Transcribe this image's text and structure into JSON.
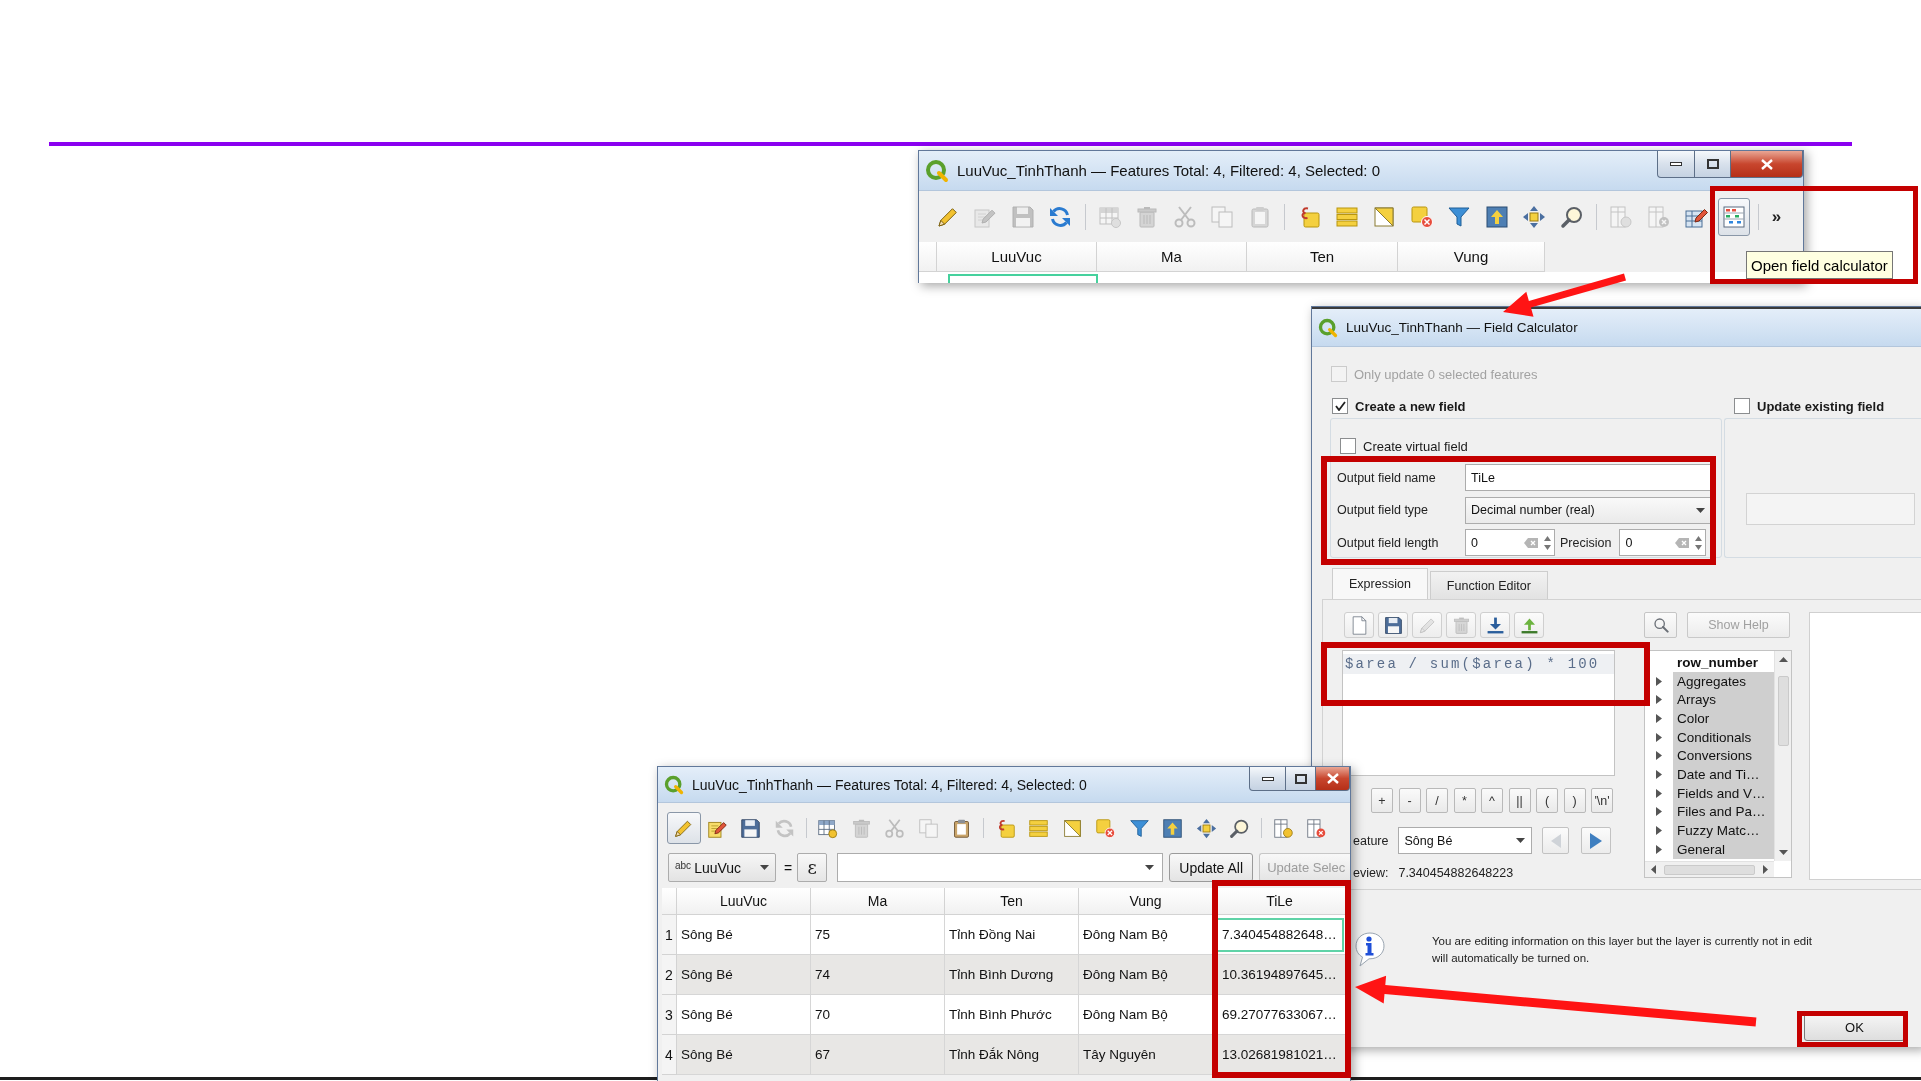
{
  "top_window": {
    "title": "LuuVuc_TinhThanh — Features Total: 4, Filtered: 4, Selected: 0",
    "toolbar": [
      [
        {
          "disabled": false,
          "active": false
        },
        {
          "disabled": true,
          "active": false
        },
        {
          "disabled": true,
          "active": false
        },
        {
          "disabled": false,
          "active": false
        }
      ],
      [
        {
          "disabled": true,
          "active": false
        },
        {
          "disabled": true,
          "active": false
        },
        {
          "disabled": true,
          "active": false
        },
        {
          "disabled": true,
          "active": false
        },
        {
          "disabled": true,
          "active": false
        }
      ],
      [
        {
          "disabled": false,
          "active": false
        },
        {
          "disabled": false,
          "active": false
        },
        {
          "disabled": false,
          "active": false
        },
        {
          "disabled": false,
          "active": false
        },
        {
          "disabled": false,
          "active": false
        },
        {
          "disabled": false,
          "active": false
        },
        {
          "disabled": false,
          "active": false
        },
        {
          "disabled": false,
          "active": false
        }
      ],
      [
        {
          "disabled": true,
          "active": false
        },
        {
          "disabled": true,
          "active": false
        },
        {
          "disabled": false,
          "active": false
        },
        {
          "disabled": false,
          "active": true
        }
      ]
    ],
    "overflow_button": "»",
    "columns": [
      "LuuVuc",
      "Ma",
      "Ten",
      "Vung"
    ],
    "partial_row": {
      "focused": true
    },
    "tooltip": "Open field calculator"
  },
  "field_calculator": {
    "title": "LuuVuc_TinhThanh — Field Calculator",
    "only_selected": {
      "label": "Only update 0 selected features",
      "checked": false,
      "disabled": true
    },
    "create_new_field": {
      "label": "Create a new field",
      "checked": true
    },
    "update_existing": {
      "label": "Update existing field",
      "checked": false
    },
    "virtual_field": {
      "label": "Create virtual field",
      "checked": false
    },
    "form": {
      "name_label": "Output field name",
      "name_value": "TiLe",
      "type_label": "Output field type",
      "type_value": "Decimal number (real)",
      "length_label": "Output field length",
      "length_value": "0",
      "precision_label": "Precision",
      "precision_value": "0"
    },
    "tabs": [
      {
        "label": "Expression",
        "selected": true
      },
      {
        "label": "Function Editor",
        "selected": false
      }
    ],
    "expression_toolbar": [
      {
        "disabled": false
      },
      {
        "disabled": false
      },
      {
        "disabled": true
      },
      {
        "disabled": true
      },
      {
        "disabled": false
      },
      {
        "disabled": false
      }
    ],
    "expression": "$area / sum($area) * 100",
    "operators": [
      "+",
      "-",
      "/",
      "*",
      "^",
      "||",
      "(",
      ")",
      "'\\n'"
    ],
    "feature": {
      "label": "eature",
      "value": "Sông Bé"
    },
    "feature_nav": [
      {
        "disabled": true
      },
      {
        "disabled": false
      }
    ],
    "preview": {
      "label": "eview:",
      "value": "7.340454882648223"
    },
    "show_help": {
      "label": "Show Help",
      "disabled": true
    },
    "functions": [
      {
        "label": "row_number",
        "kind": "function",
        "selected": false
      },
      {
        "label": "Aggregates",
        "kind": "group",
        "selected": true
      },
      {
        "label": "Arrays",
        "kind": "group",
        "selected": true
      },
      {
        "label": "Color",
        "kind": "group",
        "selected": true
      },
      {
        "label": "Conditionals",
        "kind": "group",
        "selected": true
      },
      {
        "label": "Conversions",
        "kind": "group",
        "selected": true
      },
      {
        "label": "Date and Ti…",
        "kind": "group",
        "selected": true
      },
      {
        "label": "Fields and V…",
        "kind": "group",
        "selected": true
      },
      {
        "label": "Files and Pa…",
        "kind": "group",
        "selected": true
      },
      {
        "label": "Fuzzy Matc…",
        "kind": "group",
        "selected": true
      },
      {
        "label": "General",
        "kind": "group",
        "selected": true
      }
    ],
    "message": [
      "You are editing information on this layer but the layer is currently not in edit",
      "will automatically be turned on."
    ],
    "ok_button": "OK"
  },
  "bottom_window": {
    "title": "LuuVuc_TinhThanh — Features Total: 4, Filtered: 4, Selected: 0",
    "toolbar": [
      [
        {
          "disabled": false,
          "active": true
        },
        {
          "disabled": false,
          "active": false
        },
        {
          "disabled": false,
          "active": false
        },
        {
          "disabled": true,
          "active": false
        }
      ],
      [
        {
          "disabled": false,
          "active": false
        },
        {
          "disabled": true,
          "active": false
        },
        {
          "disabled": true,
          "active": false
        },
        {
          "disabled": true,
          "active": false
        },
        {
          "disabled": false,
          "active": false
        }
      ],
      [
        {
          "disabled": false,
          "active": false
        },
        {
          "disabled": false,
          "active": false
        },
        {
          "disabled": false,
          "active": false
        },
        {
          "disabled": false,
          "active": false
        },
        {
          "disabled": false,
          "active": false
        },
        {
          "disabled": false,
          "active": false
        },
        {
          "disabled": false,
          "active": false
        },
        {
          "disabled": false,
          "active": false
        }
      ],
      [
        {
          "disabled": false,
          "active": false
        },
        {
          "disabled": false,
          "active": false
        }
      ]
    ],
    "field_dropdown": {
      "type": "abc",
      "value": "LuuVuc"
    },
    "equals": "=",
    "expression_button": "ε",
    "update_all": "Update All",
    "update_selected": {
      "label": "Update Selec",
      "disabled": true
    },
    "columns": [
      "LuuVuc",
      "Ma",
      "Ten",
      "Vung",
      "TiLe"
    ],
    "rows": [
      {
        "number": "1",
        "cells": [
          "Sông Bé",
          "75",
          "Tỉnh Đồng Nai",
          "Đông Nam Bộ",
          "7.340454882648…"
        ],
        "focused": true
      },
      {
        "number": "2",
        "cells": [
          "Sông Bé",
          "74",
          "Tỉnh Bình Dương",
          "Đông Nam Bộ",
          "10.36194897645…"
        ],
        "focused": false
      },
      {
        "number": "3",
        "cells": [
          "Sông Bé",
          "70",
          "Tỉnh Bình Phước",
          "Đông Nam Bộ",
          "69.27077633067…"
        ],
        "focused": false
      },
      {
        "number": "4",
        "cells": [
          "Sông Bé",
          "67",
          "Tỉnh Đắk Nông",
          "Tây Nguyên",
          "13.02681981021…"
        ],
        "focused": false
      }
    ]
  }
}
